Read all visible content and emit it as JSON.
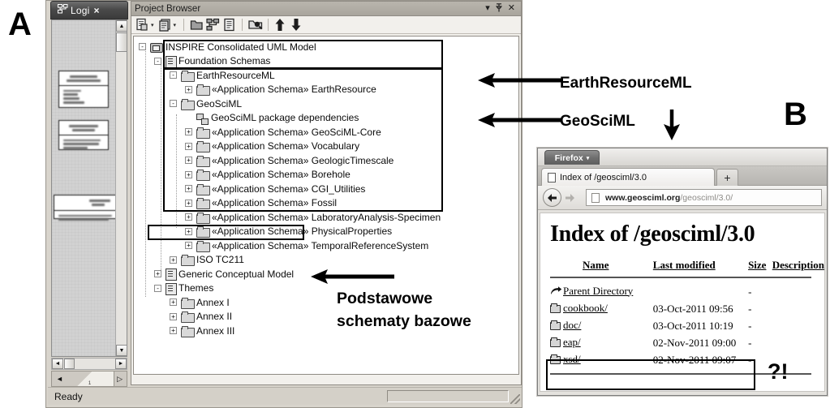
{
  "annotations": {
    "label_a": "A",
    "label_b": "B",
    "earthresourceml": "EarthResourceML",
    "geosciml": "GeoSciML",
    "podstawowe_line1": "Podstawowe",
    "podstawowe_line2": "schematy bazowe",
    "question": "?!"
  },
  "ea": {
    "tab": {
      "label": "Logi",
      "close": "×",
      "icon": "uml-diagram-icon"
    },
    "status": {
      "text": "Ready"
    },
    "scroll": {
      "up": "▲",
      "down": "▼",
      "left": "◄",
      "right": "►"
    },
    "bottom_tabs": {
      "prev": "◄",
      "next": "▷",
      "page": "1"
    }
  },
  "project_browser": {
    "title": "Project Browser",
    "window_controls": {
      "dropdown": "▾",
      "pin": "✕",
      "close": "✕",
      "pin_glyph": "⯑"
    },
    "toolbar": [
      {
        "name": "new-package-icon",
        "caret": true
      },
      {
        "name": "new-diagram-icon",
        "caret": true
      },
      {
        "name": "open-package-icon",
        "caret": false
      },
      {
        "name": "model-view-icon",
        "caret": false
      },
      {
        "name": "documentation-icon",
        "caret": false
      },
      {
        "name": "search-model-icon",
        "caret": false
      },
      {
        "name": "move-up-icon",
        "caret": false
      },
      {
        "name": "move-down-icon",
        "caret": false
      }
    ],
    "tree": [
      {
        "label": "INSPIRE Consolidated UML Model",
        "depth": 0,
        "expander": "-",
        "icon": "model-icon"
      },
      {
        "label": "Foundation Schemas",
        "depth": 1,
        "expander": "-",
        "icon": "doc-icon"
      },
      {
        "label": "EarthResourceML",
        "depth": 2,
        "expander": "-",
        "icon": "folder-icon"
      },
      {
        "label": "«Application Schema» EarthResource",
        "depth": 3,
        "expander": "+",
        "icon": "folder-icon"
      },
      {
        "label": "GeoSciML",
        "depth": 2,
        "expander": "-",
        "icon": "folder-icon"
      },
      {
        "label": "GeoSciML package dependencies",
        "depth": 3,
        "expander": "",
        "icon": "package-dependency-icon"
      },
      {
        "label": "«Application Schema» GeoSciML-Core",
        "depth": 3,
        "expander": "+",
        "icon": "folder-icon"
      },
      {
        "label": "«Application Schema» Vocabulary",
        "depth": 3,
        "expander": "+",
        "icon": "folder-icon"
      },
      {
        "label": "«Application Schema» GeologicTimescale",
        "depth": 3,
        "expander": "+",
        "icon": "folder-icon"
      },
      {
        "label": "«Application Schema» Borehole",
        "depth": 3,
        "expander": "+",
        "icon": "folder-icon"
      },
      {
        "label": "«Application Schema» CGI_Utilities",
        "depth": 3,
        "expander": "+",
        "icon": "folder-icon"
      },
      {
        "label": "«Application Schema» Fossil",
        "depth": 3,
        "expander": "+",
        "icon": "folder-icon"
      },
      {
        "label": "«Application Schema» LaboratoryAnalysis-Specimen",
        "depth": 3,
        "expander": "+",
        "icon": "folder-icon"
      },
      {
        "label": "«Application Schema» PhysicalProperties",
        "depth": 3,
        "expander": "+",
        "icon": "folder-icon"
      },
      {
        "label": "«Application Schema» TemporalReferenceSystem",
        "depth": 3,
        "expander": "+",
        "icon": "folder-icon"
      },
      {
        "label": "ISO TC211",
        "depth": 2,
        "expander": "+",
        "icon": "folder-icon"
      },
      {
        "label": "Generic Conceptual Model",
        "depth": 1,
        "expander": "+",
        "icon": "doc-icon"
      },
      {
        "label": "Themes",
        "depth": 1,
        "expander": "-",
        "icon": "doc-icon"
      },
      {
        "label": "Annex I",
        "depth": 2,
        "expander": "+",
        "icon": "folder-icon"
      },
      {
        "label": "Annex II",
        "depth": 2,
        "expander": "+",
        "icon": "folder-icon"
      },
      {
        "label": "Annex III",
        "depth": 2,
        "expander": "+",
        "icon": "folder-icon"
      }
    ]
  },
  "firefox": {
    "app_button": "Firefox",
    "app_button_caret": "▾",
    "tab_title": "Index of /geosciml/3.0",
    "new_tab": "+",
    "back": "←",
    "forward": "→",
    "url_host": "www.geosciml.org",
    "url_path": "/geosciml/3.0/",
    "page": {
      "heading": "Index of /geosciml/3.0",
      "columns": [
        "Name",
        "Last modified",
        "Size",
        "Description"
      ],
      "rows": [
        {
          "icon": "parent-directory-icon",
          "name": "Parent Directory",
          "modified": "",
          "size": "-",
          "description": ""
        },
        {
          "icon": "folder-icon",
          "name": "cookbook/",
          "modified": "03-Oct-2011 09:56",
          "size": "-",
          "description": ""
        },
        {
          "icon": "folder-icon",
          "name": "doc/",
          "modified": "03-Oct-2011 10:19",
          "size": "-",
          "description": ""
        },
        {
          "icon": "folder-icon",
          "name": "eap/",
          "modified": "02-Nov-2011 09:00",
          "size": "-",
          "description": ""
        },
        {
          "icon": "folder-icon",
          "name": "xsd/",
          "modified": "02-Nov-2011 09:07",
          "size": "-",
          "description": ""
        }
      ]
    }
  }
}
